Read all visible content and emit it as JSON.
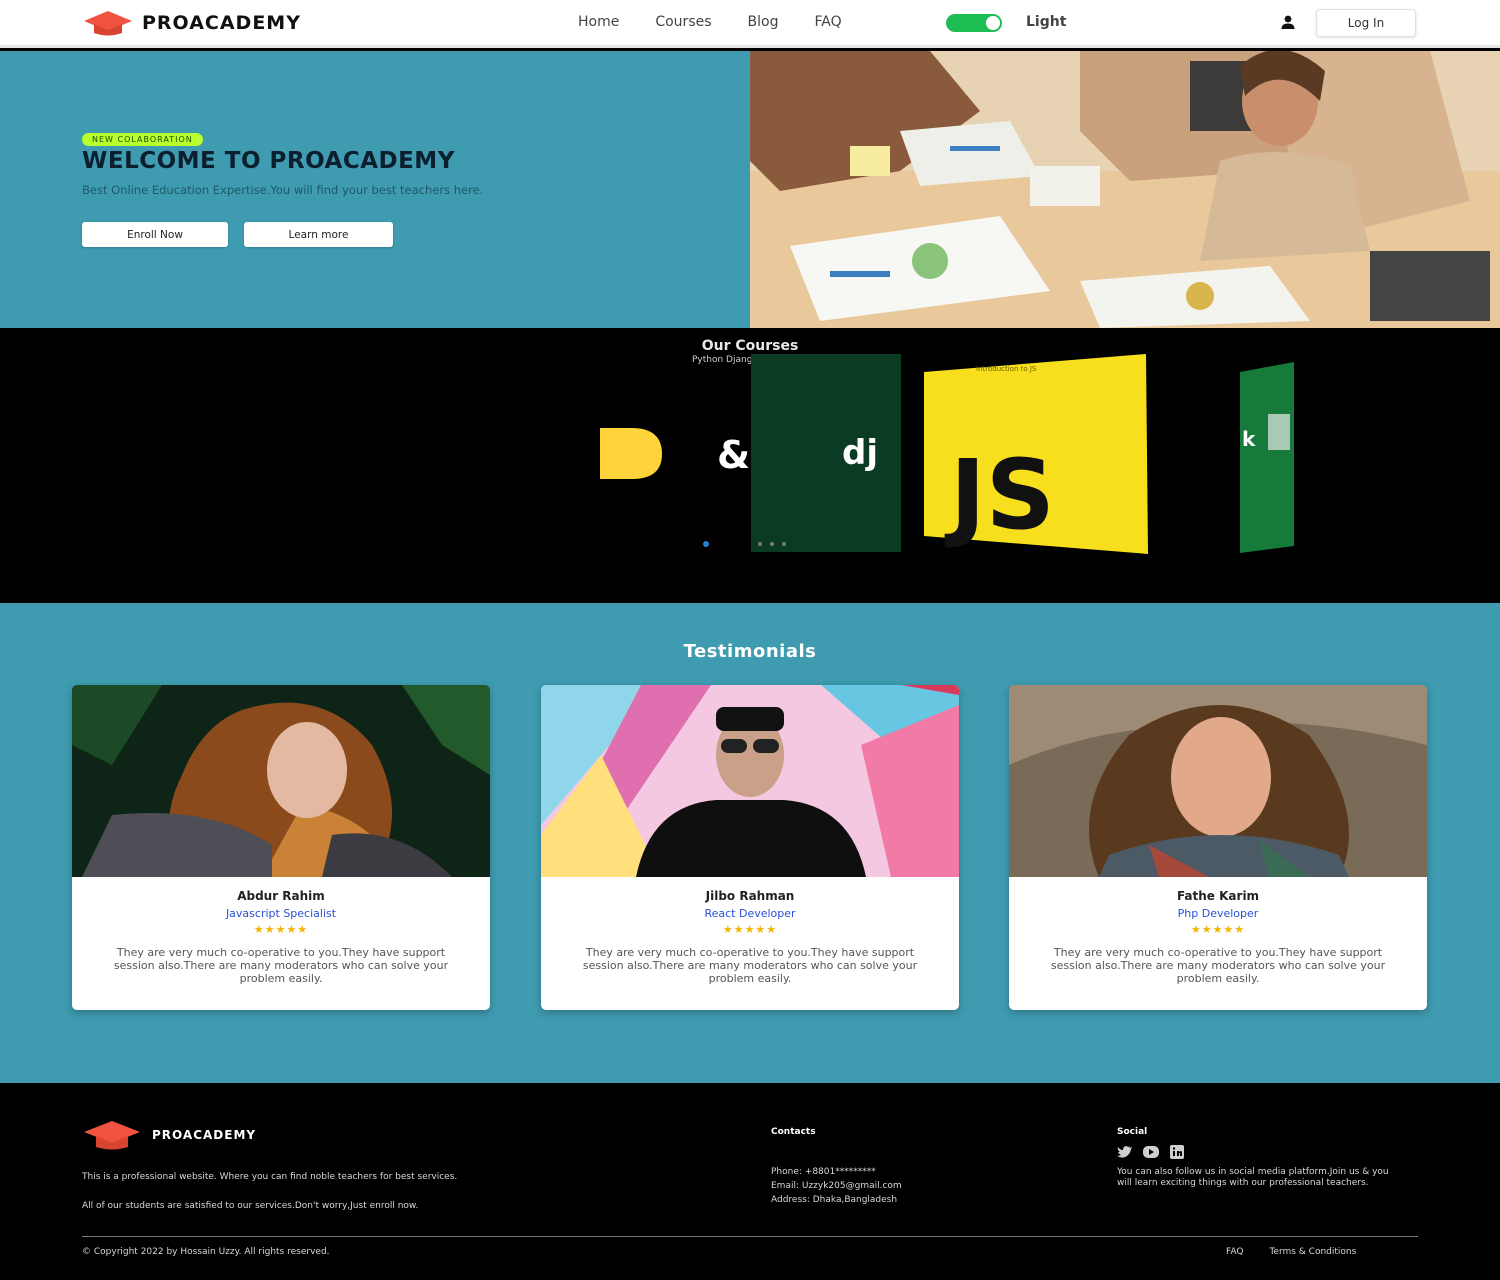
{
  "brand": {
    "name": "PROACADEMY"
  },
  "nav": {
    "links": [
      "Home",
      "Courses",
      "Blog",
      "FAQ"
    ],
    "theme_label": "Light",
    "login_label": "Log In"
  },
  "hero": {
    "badge": "NEW COLABORATION",
    "title": "WELCOME TO PROACADEMY",
    "subtitle": "Best Online Education Expertise.You will find your best teachers here.",
    "enroll_label": "Enroll Now",
    "learn_label": "Learn more"
  },
  "courses": {
    "title": "Our Courses",
    "slide_caption": "Python Django",
    "js_slide_caption": "Introduction to JS",
    "python_text": "&",
    "django_text": "dj",
    "js_text": "JS"
  },
  "testimonials": {
    "title": "Testimonials",
    "items": [
      {
        "name": "Abdur Rahim",
        "role": "Javascript Specialist",
        "stars": "★★★★★",
        "text": "They are very much co-operative to you.They have support session also.There are many moderators who can solve your problem easily."
      },
      {
        "name": "Jilbo Rahman",
        "role": "React Developer",
        "stars": "★★★★★",
        "text": "They are very much co-operative to you.They have support session also.There are many moderators who can solve your problem easily."
      },
      {
        "name": "Fathe Karim",
        "role": "Php Developer",
        "stars": "★★★★★",
        "text": "They are very much co-operative to you.They have support session also.There are many moderators who can solve your problem easily."
      }
    ]
  },
  "footer": {
    "brand": "PROACADEMY",
    "desc1": "This is a professional website. Where you can find noble teachers for best services.",
    "desc2": "All of our students are satisfied to our services.Don't worry,Just enroll now.",
    "contacts_title": "Contacts",
    "phone": "Phone: +8801*********",
    "email": "Email: Uzzyk205@gmail.com",
    "address": "Address: Dhaka,Bangladesh",
    "social_title": "Social",
    "social_text": "You can also follow us in social media platform.Join us & you will learn exciting things with our professional teachers.",
    "copyright": "© Copyright 2022 by Hossain Uzzy. All rights reserved.",
    "faq_link": "FAQ",
    "terms_link": "Terms & Conditions"
  },
  "colors": {
    "accent_teal": "#3e9bb0",
    "toggle_green": "#1fbe54",
    "badge_lime": "#b8ff2e",
    "role_blue": "#2a50d8",
    "star_gold": "#f5b400",
    "logo_red": "#f0533f",
    "js_yellow": "#f7df1e",
    "django_green": "#0c3b24"
  }
}
